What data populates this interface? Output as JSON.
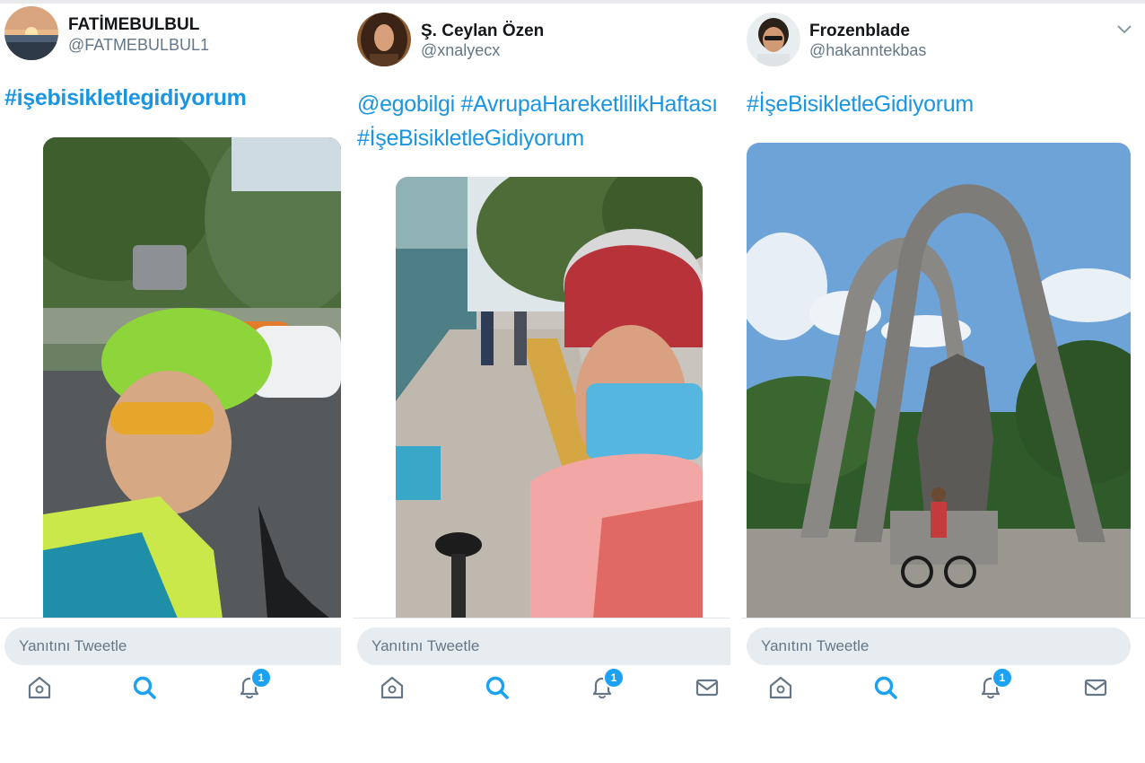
{
  "columns": [
    {
      "name": "FATİMEBULBUL",
      "handle": "@FATMEBULBUL1",
      "tweet_text": "#işebisikletlegidiyorum",
      "reply_placeholder": "Yanıtını Tweetle",
      "notification_count": "1",
      "nav": [
        "home-icon",
        "search-icon",
        "notifications-icon"
      ]
    },
    {
      "name": "Ş. Ceylan Özen",
      "handle": "@xnalyecx",
      "tweet_text": "@egobilgi #AvrupaHareketlilikHaftası #İşeBisikletleGidiyorum",
      "reply_placeholder": "Yanıtını Tweetle",
      "notification_count": "1",
      "nav": [
        "home-icon",
        "search-icon",
        "notifications-icon",
        "messages-icon"
      ]
    },
    {
      "name": "Frozenblade",
      "handle": "@hakanntekbas",
      "tweet_text": "#İşeBisikletleGidiyorum",
      "reply_placeholder": "Yanıtını Tweetle",
      "notification_count": "1",
      "nav": [
        "home-icon",
        "search-icon",
        "notifications-icon",
        "messages-icon"
      ],
      "has_menu": true
    }
  ],
  "colors": {
    "link": "#1b95e0",
    "accent": "#1da1f2",
    "name": "#14171a",
    "handle": "#657786",
    "reply_bg": "#e6ecf0"
  }
}
